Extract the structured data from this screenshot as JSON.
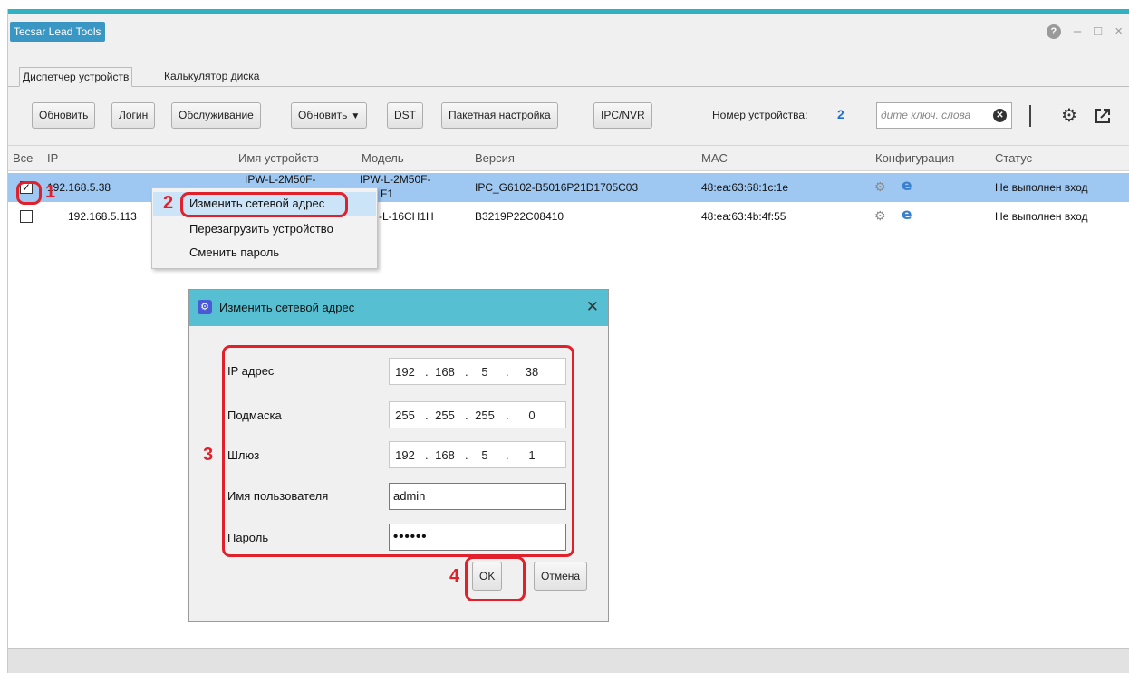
{
  "window": {
    "title": "Tecsar Lead Tools"
  },
  "tabs": [
    {
      "label": "Диспетчер устройств"
    },
    {
      "label": "Калькулятор диска"
    }
  ],
  "toolbar": {
    "refresh_label": "Обновить",
    "login_label": "Логин",
    "maintenance_label": "Обслуживание",
    "update_label": "Обновить",
    "dst_label": "DST",
    "batch_label": "Пакетная настройка",
    "ipcnvr_label": "IPC/NVR",
    "device_count_label": "Номер устройства:",
    "device_count": "2",
    "search_placeholder": "дите ключ. слова"
  },
  "table": {
    "headers": {
      "all": "Все",
      "ip": "IP",
      "name": "Имя устройств",
      "model": "Модель",
      "version": "Версия",
      "mac": "MAC",
      "config": "Конфигурация",
      "status": "Статус"
    },
    "rows": [
      {
        "checked": true,
        "ip": "192.168.5.38",
        "name": "IPW-L-2M50F-",
        "model": "IPW-L-2M50F-",
        "model_tail": "F1",
        "version": "IPC_G6102-B5016P21D1705C03",
        "mac": "48:ea:63:68:1c:1e",
        "status": "Не выполнен вход"
      },
      {
        "checked": false,
        "ip": "192.168.5.113",
        "name": "",
        "model": "-L-16CH1H",
        "version": "B3219P22C08410",
        "mac": "48:ea:63:4b:4f:55",
        "status": "Не выполнен вход"
      }
    ]
  },
  "context_menu": {
    "items": [
      {
        "label": "Изменить сетевой адрес"
      },
      {
        "label": "Перезагрузить устройство"
      },
      {
        "label": "Сменить пароль"
      }
    ]
  },
  "dialog": {
    "title": "Изменить сетевой адрес",
    "ip_label": "IP адрес",
    "ip": [
      "192",
      "168",
      "5",
      "38"
    ],
    "mask_label": "Подмаска",
    "mask": [
      "255",
      "255",
      "255",
      "0"
    ],
    "gateway_label": "Шлюз",
    "gateway": [
      "192",
      "168",
      "5",
      "1"
    ],
    "username_label": "Имя пользователя",
    "username": "admin",
    "password_label": "Пароль",
    "password_mask": "••••••",
    "ok_label": "OK",
    "cancel_label": "Отмена"
  },
  "annotations": {
    "step1": "1",
    "step2": "2",
    "step3": "3",
    "step4": "4"
  },
  "colors": {
    "accent": "#2fb3c3",
    "selection": "#9ec8f2",
    "dialog_header": "#56bfd1",
    "highlight_red": "#e0202a",
    "link_blue": "#1e6fc8"
  }
}
